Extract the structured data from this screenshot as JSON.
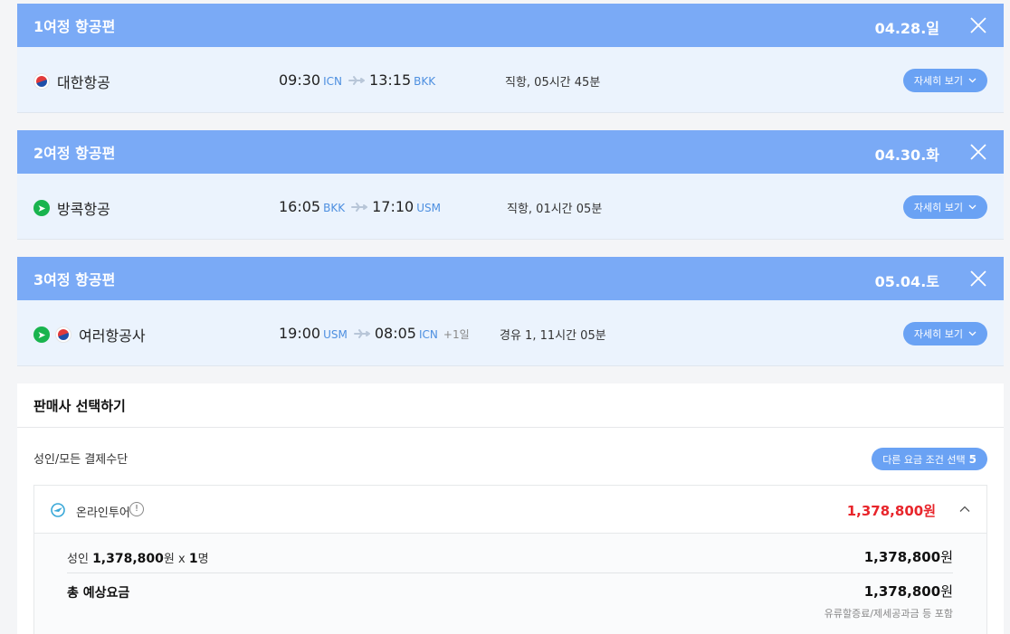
{
  "flights": [
    {
      "title": "1여정 항공편",
      "date": "04.28.일",
      "airline": "대한항공",
      "logos": [
        "korean-air"
      ],
      "dep_time": "09:30",
      "dep_code": "ICN",
      "arr_time": "13:15",
      "arr_code": "BKK",
      "plus_day": "",
      "info": "직항, 05시간 45분",
      "detail_label": "자세히 보기"
    },
    {
      "title": "2여정 항공편",
      "date": "04.30.화",
      "airline": "방콕항공",
      "logos": [
        "bangkok-airways"
      ],
      "dep_time": "16:05",
      "dep_code": "BKK",
      "arr_time": "17:10",
      "arr_code": "USM",
      "plus_day": "",
      "info": "직항, 01시간 05분",
      "detail_label": "자세히 보기"
    },
    {
      "title": "3여정 항공편",
      "date": "05.04.토",
      "airline": "여러항공사",
      "logos": [
        "bangkok-airways",
        "korean-air"
      ],
      "dep_time": "19:00",
      "dep_code": "USM",
      "arr_time": "08:05",
      "arr_code": "ICN",
      "plus_day": "+1일",
      "info": "경유 1, 11시간 05분",
      "detail_label": "자세히 보기"
    }
  ],
  "seller": {
    "title": "판매사 선택하기",
    "fare_condition": "성인/모든 결제수단",
    "other_fare_label": "다른 요금 조건 선택",
    "other_fare_count": "5",
    "agency": {
      "name": "온라인투어",
      "info_icon": "!",
      "price": "1,378,800원",
      "breakdown_prefix": "성인",
      "breakdown_amount": "1,378,800",
      "breakdown_unit": "원 x",
      "breakdown_count": "1",
      "breakdown_suffix": "명",
      "breakdown_price": "1,378,800",
      "total_label": "총 예상요금",
      "total_price": "1,378,800",
      "won": "원",
      "note": "유류할증료/제세공과금 등 포함"
    }
  },
  "colors": {
    "header_blue": "#7aaaf6",
    "row_bg": "#ebf3fd",
    "price_red": "#e8252b",
    "code_blue": "#4d8fe0"
  }
}
